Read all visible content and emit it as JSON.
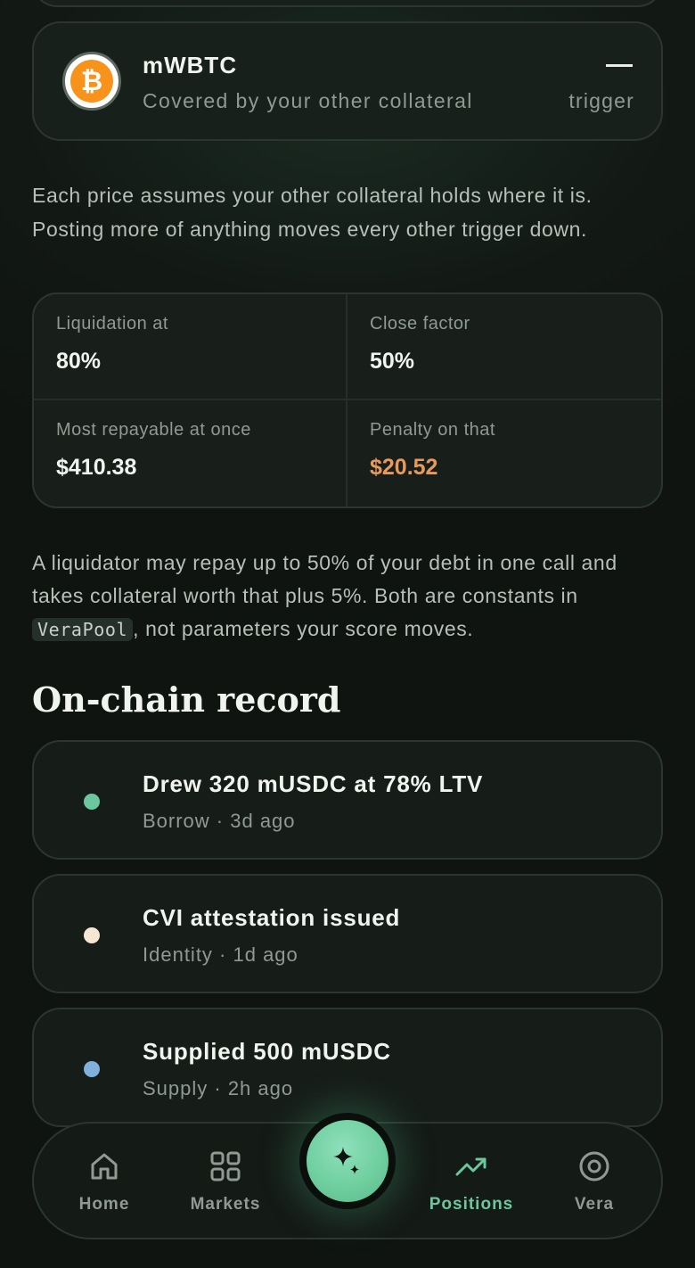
{
  "collateral": {
    "asset_name": "mWBTC",
    "asset_symbol": "₿",
    "subtitle": "Covered by your other collateral",
    "value": "—",
    "trigger_label": "trigger"
  },
  "explainer": {
    "text": "Each price assumes your other collateral holds where it is. Posting more of anything moves every other trigger down."
  },
  "risk_params": {
    "liquidation_label": "Liquidation at",
    "liquidation_value": "80%",
    "close_factor_label": "Close factor",
    "close_factor_value": "50%",
    "max_repay_label": "Most repayable at once",
    "max_repay_value": "$410.38",
    "penalty_label": "Penalty on that",
    "penalty_value": "$20.52"
  },
  "liquidator_note": {
    "text_before": "A liquidator may repay up to 50% of your debt in one call and takes collateral worth that plus 5%. Both are constants in ",
    "code": "VeraPool",
    "text_after": ", not parameters your score moves."
  },
  "onchain": {
    "title": "On-chain record",
    "items": [
      {
        "title": "Drew 320 mUSDC at 78% LTV",
        "subtitle": "Borrow · 3d ago",
        "dot_color": "#6cc79f"
      },
      {
        "title": "CVI attestation issued",
        "subtitle": "Identity · 1d ago",
        "dot_color": "#f7e6d2"
      },
      {
        "title": "Supplied 500 mUSDC",
        "subtitle": "Supply · 2h ago",
        "dot_color": "#7fb1dc"
      }
    ]
  },
  "nav": {
    "home": "Home",
    "markets": "Markets",
    "positions": "Positions",
    "vera": "Vera",
    "active": "positions",
    "accent": "#6cc79f"
  }
}
